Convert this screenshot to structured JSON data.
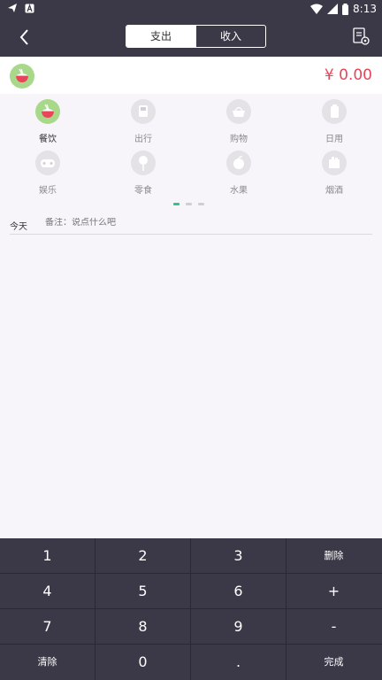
{
  "status_bar": {
    "time": "8:13",
    "icons": [
      "telegram-icon",
      "a-icon",
      "wifi-icon",
      "signal-icon",
      "battery-icon"
    ]
  },
  "header": {
    "tabs": [
      {
        "label": "支出",
        "active": true
      },
      {
        "label": "收入",
        "active": false
      }
    ],
    "back_icon": "chevron-left-icon",
    "bill_icon": "bill-settings-icon"
  },
  "amount": {
    "value": "¥ 0.00",
    "category_icon": "bowl-icon"
  },
  "categories": [
    {
      "label": "餐饮",
      "icon": "bowl-icon",
      "active": true
    },
    {
      "label": "出行",
      "icon": "bus-icon",
      "active": false
    },
    {
      "label": "购物",
      "icon": "basket-icon",
      "active": false
    },
    {
      "label": "日用",
      "icon": "tissue-icon",
      "active": false
    },
    {
      "label": "娱乐",
      "icon": "gamepad-icon",
      "active": false
    },
    {
      "label": "零食",
      "icon": "lollipop-icon",
      "active": false
    },
    {
      "label": "水果",
      "icon": "apple-icon",
      "active": false
    },
    {
      "label": "烟酒",
      "icon": "cigarette-icon",
      "active": false
    }
  ],
  "pager": {
    "pages": 3,
    "current": 1
  },
  "note": {
    "date": "今天",
    "placeholder": "备注：说点什么吧"
  },
  "keypad": {
    "rows": [
      [
        "1",
        "2",
        "3",
        "删除"
      ],
      [
        "4",
        "5",
        "6",
        "+"
      ],
      [
        "7",
        "8",
        "9",
        "-"
      ],
      [
        "清除",
        "0",
        ".",
        "完成"
      ]
    ]
  },
  "colors": {
    "dark": "#3b3847",
    "amount": "#e8445a",
    "accent_green": "#a8d98a",
    "pager_active": "#3ac08a"
  }
}
